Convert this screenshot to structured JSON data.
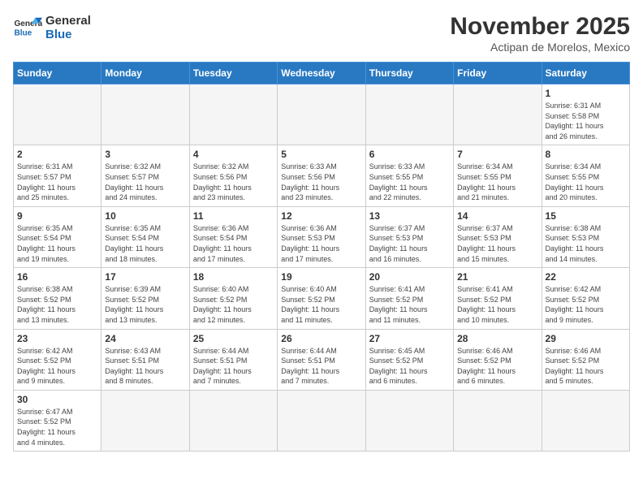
{
  "header": {
    "logo_general": "General",
    "logo_blue": "Blue",
    "month_title": "November 2025",
    "location": "Actipan de Morelos, Mexico"
  },
  "weekdays": [
    "Sunday",
    "Monday",
    "Tuesday",
    "Wednesday",
    "Thursday",
    "Friday",
    "Saturday"
  ],
  "weeks": [
    [
      {
        "day": "",
        "info": ""
      },
      {
        "day": "",
        "info": ""
      },
      {
        "day": "",
        "info": ""
      },
      {
        "day": "",
        "info": ""
      },
      {
        "day": "",
        "info": ""
      },
      {
        "day": "",
        "info": ""
      },
      {
        "day": "1",
        "info": "Sunrise: 6:31 AM\nSunset: 5:58 PM\nDaylight: 11 hours\nand 26 minutes."
      }
    ],
    [
      {
        "day": "2",
        "info": "Sunrise: 6:31 AM\nSunset: 5:57 PM\nDaylight: 11 hours\nand 25 minutes."
      },
      {
        "day": "3",
        "info": "Sunrise: 6:32 AM\nSunset: 5:57 PM\nDaylight: 11 hours\nand 24 minutes."
      },
      {
        "day": "4",
        "info": "Sunrise: 6:32 AM\nSunset: 5:56 PM\nDaylight: 11 hours\nand 23 minutes."
      },
      {
        "day": "5",
        "info": "Sunrise: 6:33 AM\nSunset: 5:56 PM\nDaylight: 11 hours\nand 23 minutes."
      },
      {
        "day": "6",
        "info": "Sunrise: 6:33 AM\nSunset: 5:55 PM\nDaylight: 11 hours\nand 22 minutes."
      },
      {
        "day": "7",
        "info": "Sunrise: 6:34 AM\nSunset: 5:55 PM\nDaylight: 11 hours\nand 21 minutes."
      },
      {
        "day": "8",
        "info": "Sunrise: 6:34 AM\nSunset: 5:55 PM\nDaylight: 11 hours\nand 20 minutes."
      }
    ],
    [
      {
        "day": "9",
        "info": "Sunrise: 6:35 AM\nSunset: 5:54 PM\nDaylight: 11 hours\nand 19 minutes."
      },
      {
        "day": "10",
        "info": "Sunrise: 6:35 AM\nSunset: 5:54 PM\nDaylight: 11 hours\nand 18 minutes."
      },
      {
        "day": "11",
        "info": "Sunrise: 6:36 AM\nSunset: 5:54 PM\nDaylight: 11 hours\nand 17 minutes."
      },
      {
        "day": "12",
        "info": "Sunrise: 6:36 AM\nSunset: 5:53 PM\nDaylight: 11 hours\nand 17 minutes."
      },
      {
        "day": "13",
        "info": "Sunrise: 6:37 AM\nSunset: 5:53 PM\nDaylight: 11 hours\nand 16 minutes."
      },
      {
        "day": "14",
        "info": "Sunrise: 6:37 AM\nSunset: 5:53 PM\nDaylight: 11 hours\nand 15 minutes."
      },
      {
        "day": "15",
        "info": "Sunrise: 6:38 AM\nSunset: 5:53 PM\nDaylight: 11 hours\nand 14 minutes."
      }
    ],
    [
      {
        "day": "16",
        "info": "Sunrise: 6:38 AM\nSunset: 5:52 PM\nDaylight: 11 hours\nand 13 minutes."
      },
      {
        "day": "17",
        "info": "Sunrise: 6:39 AM\nSunset: 5:52 PM\nDaylight: 11 hours\nand 13 minutes."
      },
      {
        "day": "18",
        "info": "Sunrise: 6:40 AM\nSunset: 5:52 PM\nDaylight: 11 hours\nand 12 minutes."
      },
      {
        "day": "19",
        "info": "Sunrise: 6:40 AM\nSunset: 5:52 PM\nDaylight: 11 hours\nand 11 minutes."
      },
      {
        "day": "20",
        "info": "Sunrise: 6:41 AM\nSunset: 5:52 PM\nDaylight: 11 hours\nand 11 minutes."
      },
      {
        "day": "21",
        "info": "Sunrise: 6:41 AM\nSunset: 5:52 PM\nDaylight: 11 hours\nand 10 minutes."
      },
      {
        "day": "22",
        "info": "Sunrise: 6:42 AM\nSunset: 5:52 PM\nDaylight: 11 hours\nand 9 minutes."
      }
    ],
    [
      {
        "day": "23",
        "info": "Sunrise: 6:42 AM\nSunset: 5:52 PM\nDaylight: 11 hours\nand 9 minutes."
      },
      {
        "day": "24",
        "info": "Sunrise: 6:43 AM\nSunset: 5:51 PM\nDaylight: 11 hours\nand 8 minutes."
      },
      {
        "day": "25",
        "info": "Sunrise: 6:44 AM\nSunset: 5:51 PM\nDaylight: 11 hours\nand 7 minutes."
      },
      {
        "day": "26",
        "info": "Sunrise: 6:44 AM\nSunset: 5:51 PM\nDaylight: 11 hours\nand 7 minutes."
      },
      {
        "day": "27",
        "info": "Sunrise: 6:45 AM\nSunset: 5:52 PM\nDaylight: 11 hours\nand 6 minutes."
      },
      {
        "day": "28",
        "info": "Sunrise: 6:46 AM\nSunset: 5:52 PM\nDaylight: 11 hours\nand 6 minutes."
      },
      {
        "day": "29",
        "info": "Sunrise: 6:46 AM\nSunset: 5:52 PM\nDaylight: 11 hours\nand 5 minutes."
      }
    ],
    [
      {
        "day": "30",
        "info": "Sunrise: 6:47 AM\nSunset: 5:52 PM\nDaylight: 11 hours\nand 4 minutes."
      },
      {
        "day": "",
        "info": ""
      },
      {
        "day": "",
        "info": ""
      },
      {
        "day": "",
        "info": ""
      },
      {
        "day": "",
        "info": ""
      },
      {
        "day": "",
        "info": ""
      },
      {
        "day": "",
        "info": ""
      }
    ]
  ]
}
